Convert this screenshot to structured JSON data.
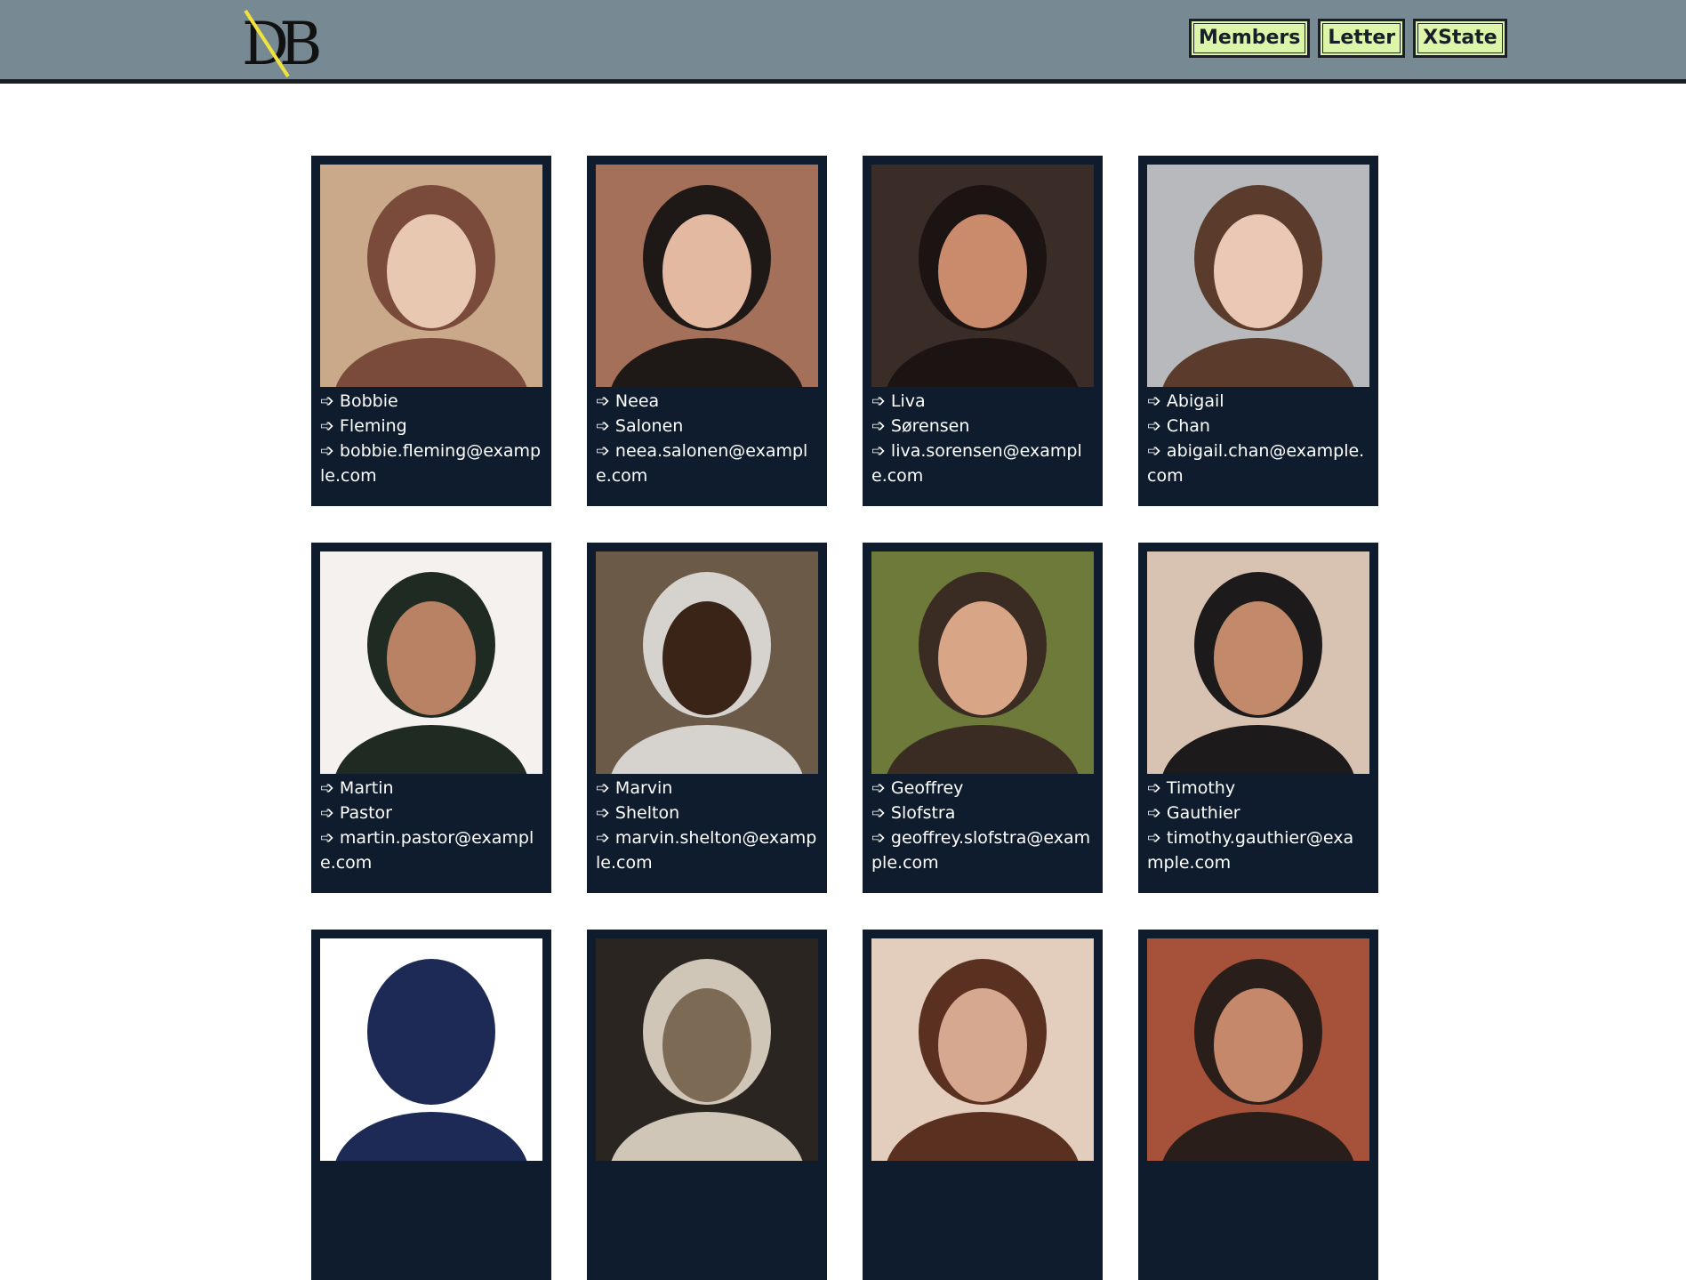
{
  "header": {
    "logo_text": "DB",
    "nav": [
      "Members",
      "Letter",
      "XState"
    ]
  },
  "colors": {
    "header_bg": "#778a93",
    "card_bg": "#0f1c2e",
    "nav_bg": "#dcf5a8",
    "logo_accent": "#f2e33b"
  },
  "arrow": "➩",
  "members": [
    {
      "first": "Bobbie",
      "last": "Fleming",
      "email": "bobbie.fleming@example.com",
      "photo": [
        "#c9a98a",
        "#7a4a3a",
        "#e8c8b0"
      ]
    },
    {
      "first": "Neea",
      "last": "Salonen",
      "email": "neea.salonen@example.com",
      "photo": [
        "#a4705a",
        "#1e1816",
        "#e3b9a2"
      ]
    },
    {
      "first": "Liva",
      "last": "Sørensen",
      "email": "liva.sorensen@example.com",
      "photo": [
        "#3a2c26",
        "#1c1412",
        "#c98b6c"
      ]
    },
    {
      "first": "Abigail",
      "last": "Chan",
      "email": "abigail.chan@example.com",
      "photo": [
        "#b7b9bd",
        "#5a3b2c",
        "#eac8b5"
      ]
    },
    {
      "first": "Martin",
      "last": "Pastor",
      "email": "martin.pastor@example.com",
      "photo": [
        "#f4f1ef",
        "#1f2a22",
        "#b98265"
      ]
    },
    {
      "first": "Marvin",
      "last": "Shelton",
      "email": "marvin.shelton@example.com",
      "photo": [
        "#6b5a48",
        "#d6d3cf",
        "#3a2418"
      ]
    },
    {
      "first": "Geoffrey",
      "last": "Slofstra",
      "email": "geoffrey.slofstra@example.com",
      "photo": [
        "#6d7a3a",
        "#3a2c22",
        "#d9a587"
      ]
    },
    {
      "first": "Timothy",
      "last": "Gauthier",
      "email": "timothy.gauthier@example.com",
      "photo": [
        "#d8c2b2",
        "#1c1a1a",
        "#c28a6a"
      ]
    },
    {
      "first": "",
      "last": "",
      "email": "",
      "photo": [
        "#ffffff",
        "#1d2a55",
        "#1d2a55"
      ]
    },
    {
      "first": "",
      "last": "",
      "email": "",
      "photo": [
        "#2a2520",
        "#cfc6b8",
        "#7d6a55"
      ]
    },
    {
      "first": "",
      "last": "",
      "email": "",
      "photo": [
        "#e3cdbc",
        "#5a3020",
        "#d7a890"
      ]
    },
    {
      "first": "",
      "last": "",
      "email": "",
      "photo": [
        "#a6523a",
        "#2a1e1a",
        "#c6886a"
      ]
    }
  ]
}
